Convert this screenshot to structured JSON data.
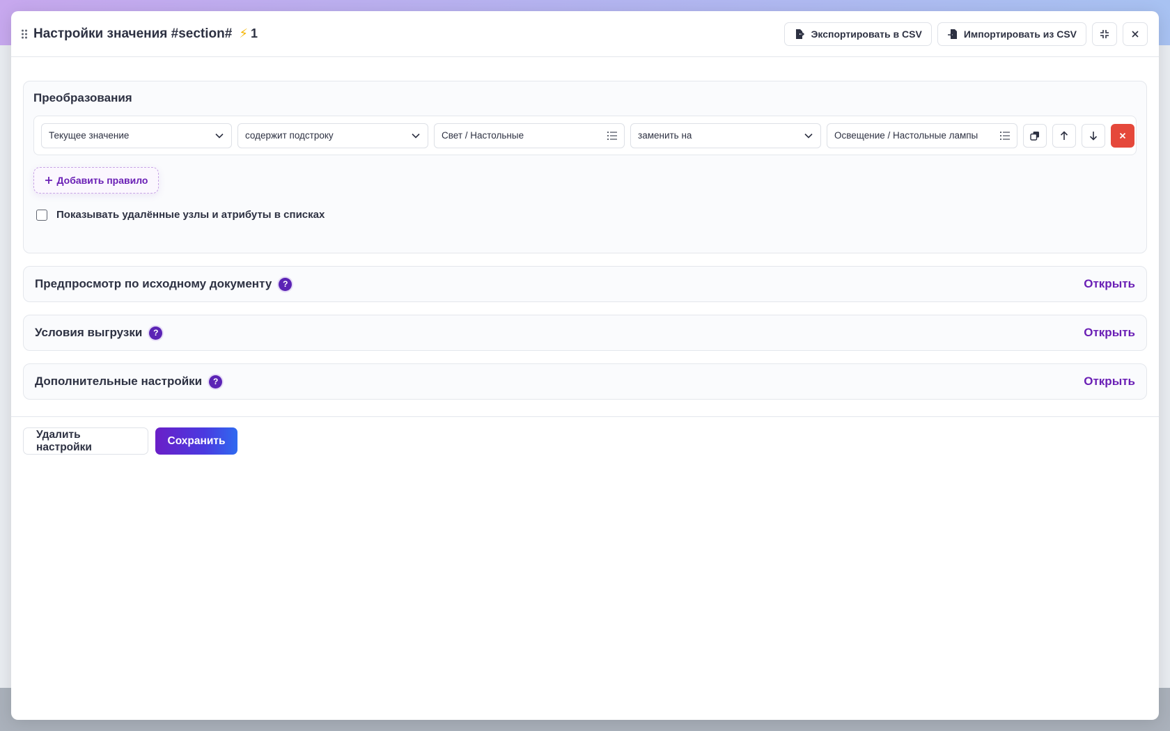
{
  "modal": {
    "title": "Настройки значения #section#",
    "bolt": "⚡",
    "count": "1",
    "export_label": "Экспортировать в CSV",
    "import_label": "Импортировать из CSV"
  },
  "transformations": {
    "title": "Преобразования",
    "rules": [
      {
        "source": "Текущее значение",
        "condition": "содержит подстроку",
        "match_value": "Свет / Настольные",
        "action": "заменить на",
        "replace_value": "Освещение / Настольные лампы"
      }
    ],
    "add_rule_label": "Добавить правило",
    "show_deleted_label": "Показывать удалённые узлы и атрибуты в списках",
    "show_deleted_checked": false
  },
  "sections": [
    {
      "title": "Предпросмотр по исходному документу",
      "help": "?",
      "action": "Открыть"
    },
    {
      "title": "Условия выгрузки",
      "help": "?",
      "action": "Открыть"
    },
    {
      "title": "Дополнительные настройки",
      "help": "?",
      "action": "Открыть"
    }
  ],
  "footer": {
    "delete_label": "Удалить настройки",
    "save_label": "Сохранить"
  },
  "colors": {
    "accent": "#6a1fb5",
    "danger": "#e5483b",
    "primary_gradient_start": "#6a1fc7",
    "primary_gradient_end": "#2f6af0"
  },
  "icons": {
    "drag": "drag-handle-icon",
    "export": "file-export-icon",
    "import": "file-import-icon",
    "collapse": "collapse-icon",
    "close": "close-icon",
    "chevron": "chevron-down-icon",
    "list": "list-icon",
    "copy": "copy-icon",
    "up": "arrow-up-icon",
    "down": "arrow-down-icon",
    "delete": "delete-icon",
    "plus": "plus-icon",
    "help": "help-icon"
  }
}
